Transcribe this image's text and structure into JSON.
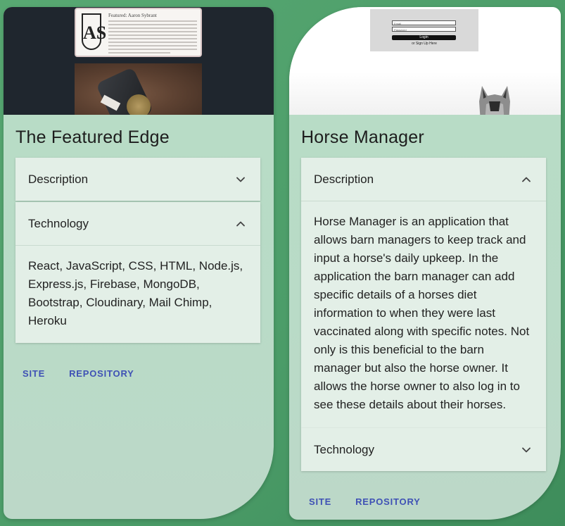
{
  "cards": [
    {
      "title": "The Featured Edge",
      "thumbnail": {
        "article_title": "Featured: Aaron Sybrant",
        "logo_text": "AS"
      },
      "accordion": [
        {
          "label": "Description",
          "expanded": false
        },
        {
          "label": "Technology",
          "expanded": true,
          "content": "React, JavaScript, CSS, HTML, Node.js, Express.js, Firebase, MongoDB, Bootstrap, Cloudinary, Mail Chimp, Heroku"
        }
      ],
      "actions": {
        "site": "SITE",
        "repository": "REPOSITORY"
      }
    },
    {
      "title": "Horse Manager",
      "thumbnail": {
        "email_placeholder": "Email",
        "password_placeholder": "Password",
        "login_button": "Login",
        "signup_text": "or Sign Up Here"
      },
      "accordion": [
        {
          "label": "Description",
          "expanded": true,
          "content": "Horse Manager is an application that allows barn managers to keep track and input a horse's daily upkeep. In the application the barn manager can add specific details of a horses diet information to when they were last vaccinated along with specific notes. Not only is this beneficial to the barn manager but also the horse owner. It allows the horse owner to also log in to see these details about their horses."
        },
        {
          "label": "Technology",
          "expanded": false
        }
      ],
      "actions": {
        "site": "SITE",
        "repository": "REPOSITORY"
      }
    }
  ],
  "colors": {
    "background": "#4f9f6b",
    "card": "#b7dcc5",
    "accordion": "#e3efe7",
    "link": "#3f51b5"
  },
  "icons": [
    "chevron-down-icon",
    "chevron-up-icon"
  ]
}
